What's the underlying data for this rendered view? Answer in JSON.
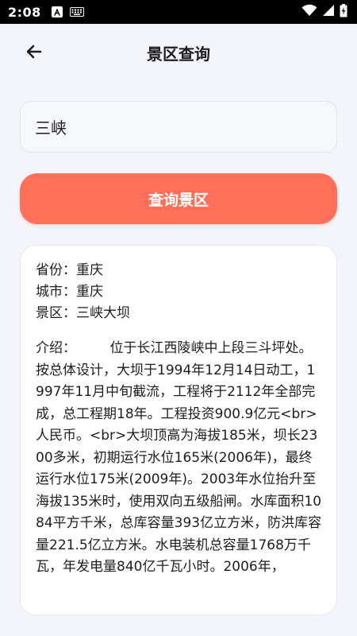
{
  "status_bar": {
    "time": "2:08",
    "icons": [
      "a-notification-icon",
      "keyboard-icon",
      "wifi-icon",
      "cellular-icon",
      "battery-icon"
    ]
  },
  "header": {
    "title": "景区查询",
    "back_icon": "arrow-left-icon"
  },
  "search": {
    "value": "三峡",
    "placeholder": ""
  },
  "query_button": {
    "label": "查询景区"
  },
  "result": {
    "province": "省份：重庆",
    "city": "城市：重庆",
    "scenic": "景区：三峡大坝",
    "intro": "介绍：　　　位于长江西陵峡中上段三斗坪处。按总体设计，大坝于1994年12月14日动工，1997年11月中旬截流，工程将于2112年全部完成，总工程期18年。工程投资900.9亿元<br>人民币。<br>大坝顶高为海拔185米，坝长2300多米，初期运行水位165米(2006年)，最终运行水位175米(2009年)。2003年水位抬升至海拔135米时，使用双向五级船闸。水库面积1084平方千米，总库容量393亿立方米，防洪库容量221.5亿立方米。水电装机总容量1768万千瓦，年发电量840亿千瓦小时。2006年，"
  },
  "colors": {
    "accent": "#ff6f59",
    "background": "#f4f5fa",
    "card": "#ffffff",
    "text": "#1d1d1f"
  }
}
